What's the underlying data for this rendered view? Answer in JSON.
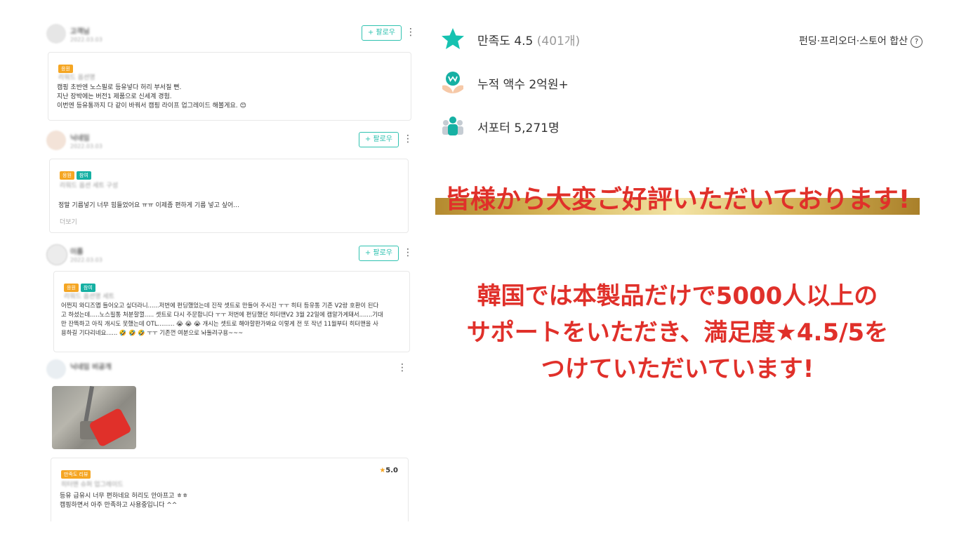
{
  "reviews": [
    {
      "follow_label": "+ 팔로우",
      "tags": [
        "응원"
      ],
      "lines": [
        "캠핑 초반엔 노스필로 등유넣다 허리 부서질 뻔.",
        "지난 장박에는 버전1 제품으로 신세계 경험.",
        "이번엔 등유통까지 다 같이 바꿔서 캠핑 라이프 업그레이드 해볼게요. 😊"
      ]
    },
    {
      "follow_label": "+ 팔로우",
      "tags": [
        "응원",
        "참여"
      ],
      "lines": [
        "정말 기름넣기 너무 힘들었어요 ㅠㅠ 이제좀 편하게 기름 넣고 싶어..."
      ],
      "more_label": "더보기"
    },
    {
      "follow_label": "+ 팔로우",
      "tags": [
        "응원",
        "참여"
      ],
      "lines": [
        "어쩐지 와디즈앱 들어오고 싶더라니......저번에 펀딩했었는데 진작 셋트로 만들어 주시진 ㅜㅜ 히터 등유통 기존 V2랑 호환이 된다",
        "고 하셨는데.....노스필통 처분할껄..... 셋트로 다시 주문합니다 ㅜㅜ 저번에 펀딩했던 히터맨V2 3월 22일에 캠알가게돼서.......기대",
        "만 잔뜩하고 아직 개시도 못했는데 OTL......... 😭 😭 😭  개시는 셋트로 해야할판가봐요 이렇게 전 또 작년 11월부터 히터맨을 사",
        "용하길 기다리네요...... 🤣 🤣 🤣  ㅜㅜ 기존껀 여분으로 놔둘려구용~~~"
      ]
    },
    {
      "tags": [
        "만족도 리뷰"
      ],
      "rating": "5.0",
      "lines": [
        "등유 급유시 너무 편하네요 허리도 안아프고 ㅎㅎ",
        "캠핑하면서 아주 만족하고 사용중입니다 ^^"
      ]
    }
  ],
  "stats": {
    "satisfaction_label": "만족도 4.5",
    "satisfaction_count": "(401개)",
    "total_amount": "누적 액수 2억원+",
    "supporters": "서포터 5,271명",
    "scope_note": "펀딩·프리오더·스토어 합산",
    "scope_help": "?"
  },
  "promo": {
    "headline": "皆様から大変ご好評いただいております!",
    "body_lines": [
      "韓国では本製品だけで5000人以上の",
      "サポートをいただき、満足度★4.5/5を",
      "つけていただいています!"
    ]
  },
  "colors": {
    "accent_teal": "#2fc2b0",
    "promo_red": "#e0302a",
    "tag_orange": "#f5a623",
    "tag_teal": "#16b0a3"
  },
  "icons": [
    "star-icon",
    "money-hands-icon",
    "supporters-icon",
    "kebab-menu-icon",
    "help-circle-icon"
  ]
}
